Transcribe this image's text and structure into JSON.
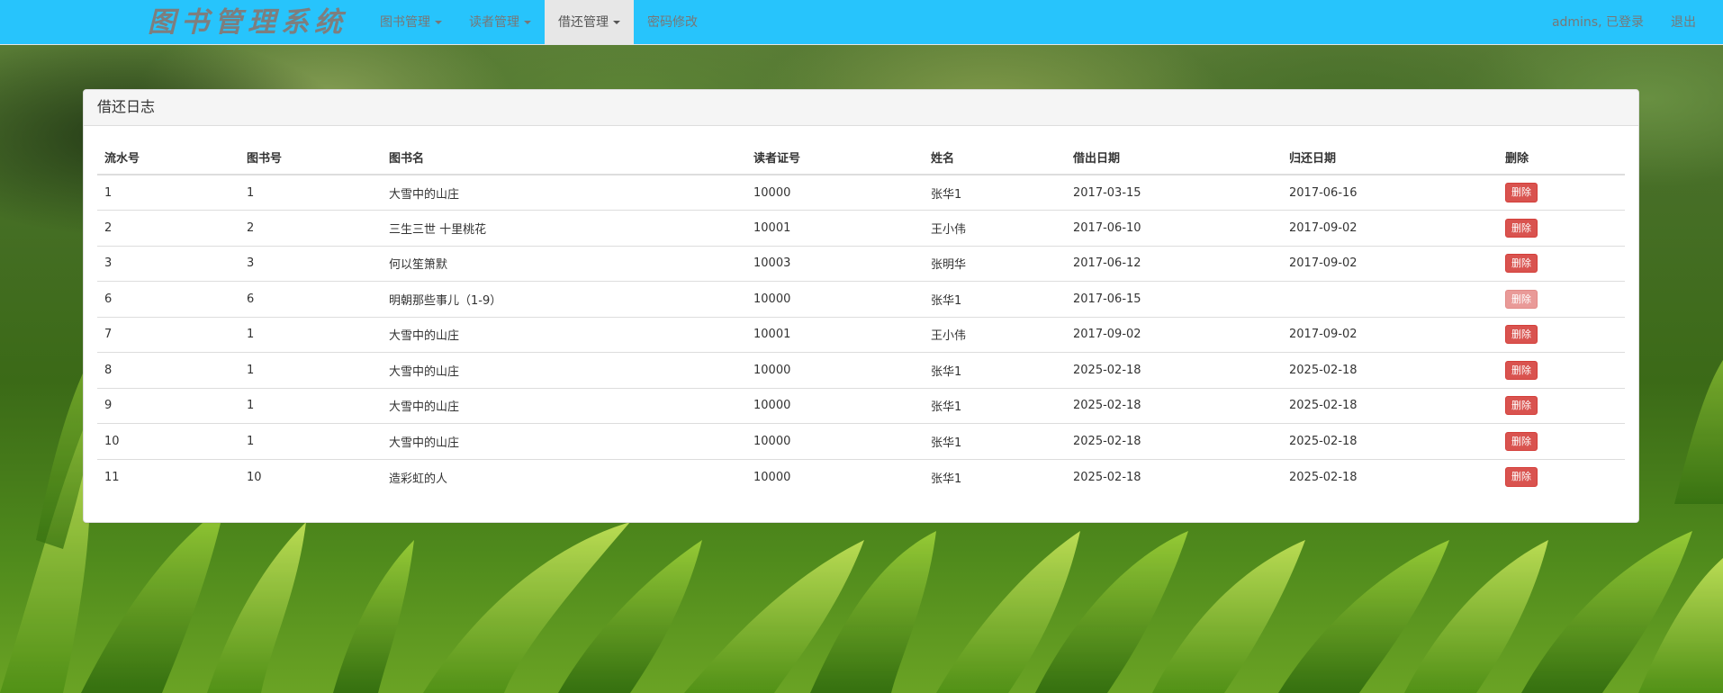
{
  "navbar": {
    "brand": "图书管理系统",
    "menus": [
      {
        "label": "图书管理",
        "dropdown": true,
        "active": false
      },
      {
        "label": "读者管理",
        "dropdown": true,
        "active": false
      },
      {
        "label": "借还管理",
        "dropdown": true,
        "active": true
      },
      {
        "label": "密码修改",
        "dropdown": false,
        "active": false
      }
    ],
    "user_status": "admins, 已登录",
    "logout_label": "退出"
  },
  "panel": {
    "title": "借还日志",
    "columns": [
      "流水号",
      "图书号",
      "图书名",
      "读者证号",
      "姓名",
      "借出日期",
      "归还日期",
      "删除"
    ],
    "delete_label": "删除",
    "rows": [
      {
        "serial": "1",
        "book_id": "1",
        "book_name": "大雪中的山庄",
        "reader_id": "10000",
        "name": "张华1",
        "lend_date": "2017-03-15",
        "back_date": "2017-06-16",
        "delete_enabled": true
      },
      {
        "serial": "2",
        "book_id": "2",
        "book_name": "三生三世 十里桃花",
        "reader_id": "10001",
        "name": "王小伟",
        "lend_date": "2017-06-10",
        "back_date": "2017-09-02",
        "delete_enabled": true
      },
      {
        "serial": "3",
        "book_id": "3",
        "book_name": "何以笙箫默",
        "reader_id": "10003",
        "name": "张明华",
        "lend_date": "2017-06-12",
        "back_date": "2017-09-02",
        "delete_enabled": true
      },
      {
        "serial": "6",
        "book_id": "6",
        "book_name": "明朝那些事儿（1-9）",
        "reader_id": "10000",
        "name": "张华1",
        "lend_date": "2017-06-15",
        "back_date": "",
        "delete_enabled": false
      },
      {
        "serial": "7",
        "book_id": "1",
        "book_name": "大雪中的山庄",
        "reader_id": "10001",
        "name": "王小伟",
        "lend_date": "2017-09-02",
        "back_date": "2017-09-02",
        "delete_enabled": true
      },
      {
        "serial": "8",
        "book_id": "1",
        "book_name": "大雪中的山庄",
        "reader_id": "10000",
        "name": "张华1",
        "lend_date": "2025-02-18",
        "back_date": "2025-02-18",
        "delete_enabled": true
      },
      {
        "serial": "9",
        "book_id": "1",
        "book_name": "大雪中的山庄",
        "reader_id": "10000",
        "name": "张华1",
        "lend_date": "2025-02-18",
        "back_date": "2025-02-18",
        "delete_enabled": true
      },
      {
        "serial": "10",
        "book_id": "1",
        "book_name": "大雪中的山庄",
        "reader_id": "10000",
        "name": "张华1",
        "lend_date": "2025-02-18",
        "back_date": "2025-02-18",
        "delete_enabled": true
      },
      {
        "serial": "11",
        "book_id": "10",
        "book_name": "造彩虹的人",
        "reader_id": "10000",
        "name": "张华1",
        "lend_date": "2025-02-18",
        "back_date": "2025-02-18",
        "delete_enabled": true
      }
    ]
  },
  "colors": {
    "navbar_bg": "#27c4fc",
    "nav_text": "#777777",
    "active_tab_bg": "#e7e7e7",
    "delete_button": "#d9534f"
  }
}
